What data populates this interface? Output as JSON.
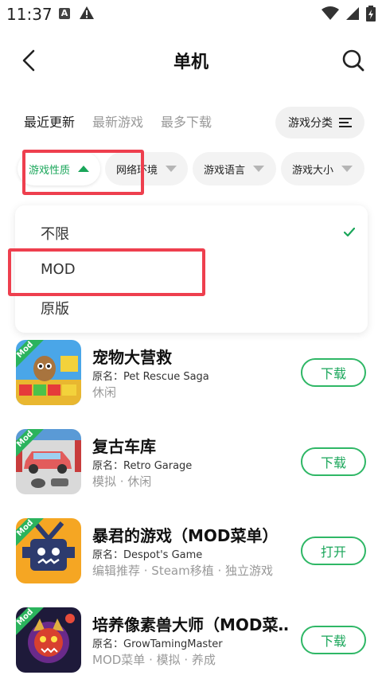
{
  "status_bar": {
    "time": "11:37",
    "a_icon": "A"
  },
  "header": {
    "title": "单机"
  },
  "tabs": [
    {
      "label": "最近更新",
      "active": true
    },
    {
      "label": "最新游戏",
      "active": false
    },
    {
      "label": "最多下载",
      "active": false
    }
  ],
  "category_button": {
    "label": "游戏分类"
  },
  "filters": [
    {
      "label": "游戏性质",
      "active": true
    },
    {
      "label": "网络环境",
      "active": false
    },
    {
      "label": "游戏语言",
      "active": false
    },
    {
      "label": "游戏大小",
      "active": false
    }
  ],
  "dropdown": {
    "options": [
      {
        "label": "不限",
        "selected": true
      },
      {
        "label": "MOD",
        "selected": false
      },
      {
        "label": "原版",
        "selected": false
      }
    ]
  },
  "games": [
    {
      "title": "宠物大营救",
      "original": "原名：Pet Rescue Saga",
      "tags": "休闲",
      "button": "下载",
      "mod_badge": "Mod"
    },
    {
      "title": "复古车库",
      "original": "原名：Retro Garage",
      "tags": "模拟 · 休闲",
      "button": "下载",
      "mod_badge": "Mod"
    },
    {
      "title": "暴君的游戏（MOD菜单）",
      "original": "原名：Despot's Game",
      "tags": "编辑推荐 · Steam移植 · 独立游戏",
      "button": "打开",
      "mod_badge": "Mod"
    },
    {
      "title": "培养像素兽大师（MOD菜…",
      "original": "原名：GrowTamingMaster",
      "tags": "MOD菜单 · 模拟 · 养成",
      "button": "下载",
      "mod_badge": "Mod"
    }
  ],
  "colors": {
    "accent": "#1aa65a",
    "highlight": "#ee3f4e"
  }
}
